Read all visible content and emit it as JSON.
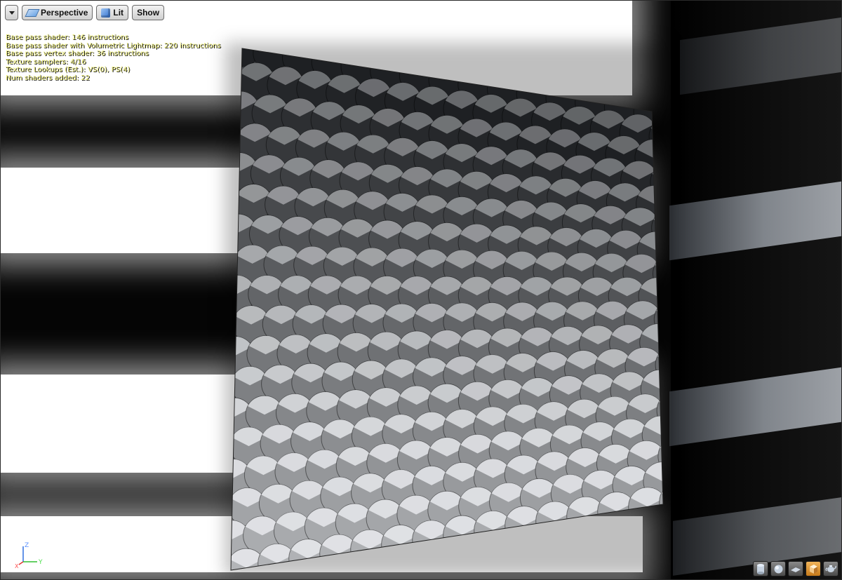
{
  "toolbar": {
    "menu_icon": "chevron-down-icon",
    "perspective_label": "Perspective",
    "perspective_icon": "perspective-icon",
    "lit_label": "Lit",
    "lit_icon": "lit-cube-icon",
    "show_label": "Show"
  },
  "stats": [
    "Base pass shader: 146 instructions",
    "Base pass shader with Volumetric Lightmap: 220 instructions",
    "Base pass vertex shader: 36 instructions",
    "Texture samplers: 4/16",
    "Texture Lookups (Est.): VS(0), PS(4)",
    "Num shaders added: 22"
  ],
  "axis": {
    "z_label": "Z",
    "x_label": "X",
    "y_label": "Y"
  },
  "preview_shapes": [
    {
      "icon": "cylinder-icon",
      "active": false
    },
    {
      "icon": "sphere-icon",
      "active": false
    },
    {
      "icon": "plane-icon",
      "active": false
    },
    {
      "icon": "cube-icon",
      "active": true
    },
    {
      "icon": "teapot-icon",
      "active": false
    }
  ],
  "colors": {
    "stats_text": "#f0f07a",
    "active_shape": "#e09a3a",
    "axis_x": "#e03030",
    "axis_y": "#30c030",
    "axis_z": "#3070e0"
  }
}
